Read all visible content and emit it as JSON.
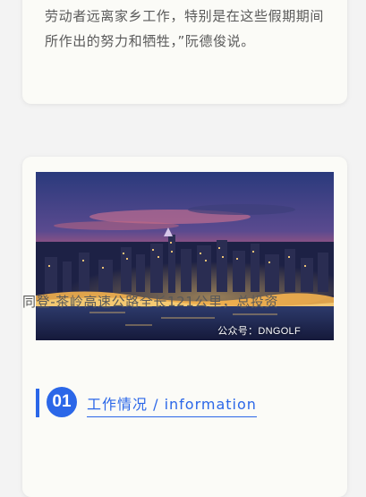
{
  "top_card": {
    "paragraph": "劳动者远离家乡工作，特别是在这些假期期间所作出的努力和牺牲，”阮德俊说。"
  },
  "bottom_card": {
    "photo": {
      "subject": "city-skyline-night-photo",
      "watermark": "公众号：DNGOLF"
    },
    "section": {
      "number": "01",
      "title": "工作情况 /  information",
      "accent_color": "#2b67e8"
    },
    "paragraph": "同登-茶岭高速公路全长121公里，总投资"
  }
}
